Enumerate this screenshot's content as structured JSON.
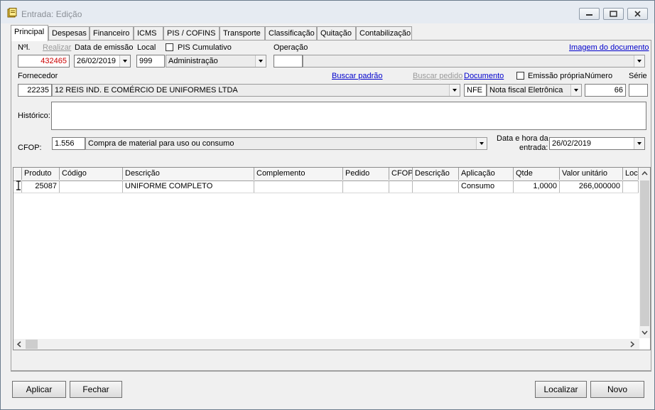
{
  "window": {
    "title": "Entrada: Edição"
  },
  "tabs": [
    {
      "label": "Principal"
    },
    {
      "label": "Despesas"
    },
    {
      "label": "Financeiro"
    },
    {
      "label": "ICMS"
    },
    {
      "label": "PIS / COFINS"
    },
    {
      "label": "Transporte"
    },
    {
      "label": "Classificação"
    },
    {
      "label": "Quitação"
    },
    {
      "label": "Contabilização"
    }
  ],
  "form": {
    "num_label": "Nºl.",
    "num_value": "432465",
    "realizar_label": "Realizar",
    "emissao_label": "Data de emissão",
    "emissao_value": "26/02/2019",
    "local_label": "Local",
    "local_code": "999",
    "local_name": "Administração",
    "pis_label": "PIS Cumulativo",
    "operacao_label": "Operação",
    "operacao_code": "",
    "operacao_value": "",
    "imagem_link": "Imagem do documento",
    "fornecedor_label": "Fornecedor",
    "buscar_padrao": "Buscar padrão",
    "buscar_pedido": "Buscar pedido",
    "documento_label": "Documento",
    "emissao_propria_label": "Emissão própria",
    "numero_label": "Número",
    "serie_label": "Série",
    "fornecedor_code": "22235",
    "fornecedor_name": "12 REIS IND. E COMÉRCIO DE UNIFORMES LTDA",
    "documento_code": "NFE",
    "documento_type": "Nota fiscal Eletrônica",
    "numero_value": "66",
    "serie_value": "",
    "historico_label": "Histórico:",
    "historico_value": "",
    "cfop_label": "CFOP:",
    "cfop_code": "1.556",
    "cfop_desc": "Compra de material para uso ou consumo",
    "data_entrada_label_1": "Data e hora da",
    "data_entrada_label_2": "entrada:",
    "data_entrada_value": "26/02/2019"
  },
  "grid": {
    "columns": [
      "Produto",
      "Código",
      "Descrição",
      "Complemento",
      "Pedido",
      "CFOP",
      "Descrição",
      "Aplicação",
      "Qtde",
      "Valor unitário",
      "Local"
    ],
    "rows": [
      {
        "produto": "25087",
        "codigo": "",
        "descricao": "UNIFORME COMPLETO",
        "complemento": "",
        "pedido": "",
        "cfop": "",
        "descricao2": "",
        "aplicacao": "Consumo",
        "qtde": "1,0000",
        "valor": "266,000000",
        "local": ""
      }
    ]
  },
  "buttons": {
    "aplicar": "Aplicar",
    "fechar": "Fechar",
    "localizar": "Localizar",
    "novo": "Novo"
  },
  "colors": {
    "accent_red": "#cc0000",
    "link_blue": "#0000cc"
  }
}
